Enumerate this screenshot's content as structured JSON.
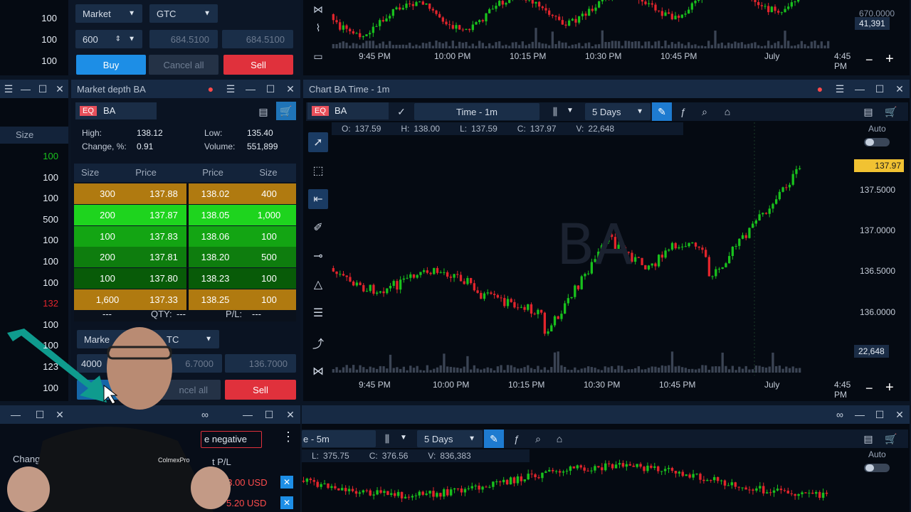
{
  "colors": {
    "buy": "#1d8ee6",
    "sell": "#e0313c",
    "up": "#19c11d",
    "down": "#e2252c",
    "badge": "#f1c232"
  },
  "left_list": {
    "header": "Size",
    "top_values": [
      "100",
      "100",
      "100"
    ],
    "values": [
      {
        "v": "100",
        "c": "#19c11d"
      },
      {
        "v": "100",
        "c": "#e6edf5"
      },
      {
        "v": "100",
        "c": "#e6edf5"
      },
      {
        "v": "500",
        "c": "#e6edf5"
      },
      {
        "v": "100",
        "c": "#e6edf5"
      },
      {
        "v": "100",
        "c": "#e6edf5"
      },
      {
        "v": "100",
        "c": "#e6edf5"
      },
      {
        "v": "132",
        "c": "#e2252c"
      },
      {
        "v": "100",
        "c": "#e6edf5"
      },
      {
        "v": "100",
        "c": "#e6edf5"
      },
      {
        "v": "123",
        "c": "#e6edf5"
      },
      {
        "v": "100",
        "c": "#e6edf5"
      }
    ]
  },
  "top_order": {
    "type": "Market",
    "tif": "GTC",
    "qty": "600",
    "price1": "684.5100",
    "price2": "684.5100",
    "buy": "Buy",
    "cancel": "Cancel all",
    "sell": "Sell"
  },
  "top_chart": {
    "price_label": "670.0000",
    "vol_badge": "41,391",
    "times": [
      "9:45 PM",
      "10:00 PM",
      "10:15 PM",
      "10:30 PM",
      "10:45 PM",
      "July",
      "4:45 PM"
    ]
  },
  "depth": {
    "title": "Market depth BA",
    "eq": "EQ",
    "symbol": "BA",
    "high_label": "High:",
    "high": "138.12",
    "low_label": "Low:",
    "low": "135.40",
    "change_label": "Change, %:",
    "change": "0.91",
    "volume_label": "Volume:",
    "volume": "551,899",
    "headers": [
      "Size",
      "Price",
      "Price",
      "Size"
    ],
    "rows": [
      {
        "bsize": "300",
        "bprice": "137.88",
        "aprice": "138.02",
        "asize": "400",
        "bc": "#b07a10",
        "ac": "#b07a10"
      },
      {
        "bsize": "200",
        "bprice": "137.87",
        "aprice": "138.05",
        "asize": "1,000",
        "bc": "#1ed41e",
        "ac": "#1ed41e"
      },
      {
        "bsize": "100",
        "bprice": "137.83",
        "aprice": "138.06",
        "asize": "100",
        "bc": "#13a513",
        "ac": "#13a513"
      },
      {
        "bsize": "200",
        "bprice": "137.81",
        "aprice": "138.20",
        "asize": "500",
        "bc": "#0e7d0e",
        "ac": "#0e7d0e"
      },
      {
        "bsize": "100",
        "bprice": "137.80",
        "aprice": "138.23",
        "asize": "100",
        "bc": "#085b08",
        "ac": "#085b08"
      },
      {
        "bsize": "1,600",
        "bprice": "137.33",
        "aprice": "138.25",
        "asize": "100",
        "bc": "#b07a10",
        "ac": "#b07a10"
      }
    ],
    "dash1": "---",
    "qty_label": "QTY:",
    "qty": "---",
    "pl_label": "P/L:",
    "pl": "---",
    "order": {
      "type": "Marke",
      "tif": "TC",
      "qty": "4000",
      "price1": "6.7000",
      "price2": "136.7000",
      "cancel": "ncel all",
      "sell": "Sell"
    }
  },
  "chart": {
    "title": "Chart BA Time - 1m",
    "eq": "EQ",
    "symbol": "BA",
    "interval": "Time - 1m",
    "range": "5 Days",
    "ohlc": {
      "o_label": "O:",
      "o": "137.59",
      "h_label": "H:",
      "h": "138.00",
      "l_label": "L:",
      "l": "137.59",
      "c_label": "C:",
      "c": "137.97",
      "v_label": "V:",
      "v": "22,648"
    },
    "watermark": "BA",
    "auto": "Auto",
    "last_price": "137.97",
    "vol_badge": "22,648",
    "yticks": [
      "137.5000",
      "137.0000",
      "136.5000",
      "136.0000"
    ],
    "times": [
      "9:45 PM",
      "10:00 PM",
      "10:15 PM",
      "10:30 PM",
      "10:45 PM",
      "July",
      "4:45 PM"
    ]
  },
  "bottom_chart": {
    "interval": "e - 5m",
    "range": "5 Days",
    "ohlc": {
      "l_label": "L:",
      "l": "375.75",
      "c_label": "C:",
      "c": "376.56",
      "v_label": "V:",
      "v": "836,383"
    },
    "auto": "Auto"
  },
  "bottom_left": {
    "filter": "e negative",
    "change": "Change",
    "pl": "t P/L",
    "v1": "23.00 USD",
    "v2": "5.20 USD",
    "brand": "ColmexPro"
  }
}
